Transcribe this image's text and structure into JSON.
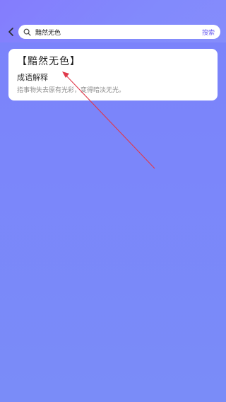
{
  "search": {
    "query": "黯然无色",
    "submit_label": "搜索"
  },
  "result": {
    "title": "【黯然无色】",
    "section": "成语解释",
    "definition": "指事物失去原有光彩，变得暗淡无光。"
  },
  "icons": {
    "back": "chevron-left-icon",
    "search": "search-icon"
  },
  "colors": {
    "background": "#7b86fa",
    "accent": "#6a5cf0",
    "annotation_arrow": "#e0394a"
  }
}
